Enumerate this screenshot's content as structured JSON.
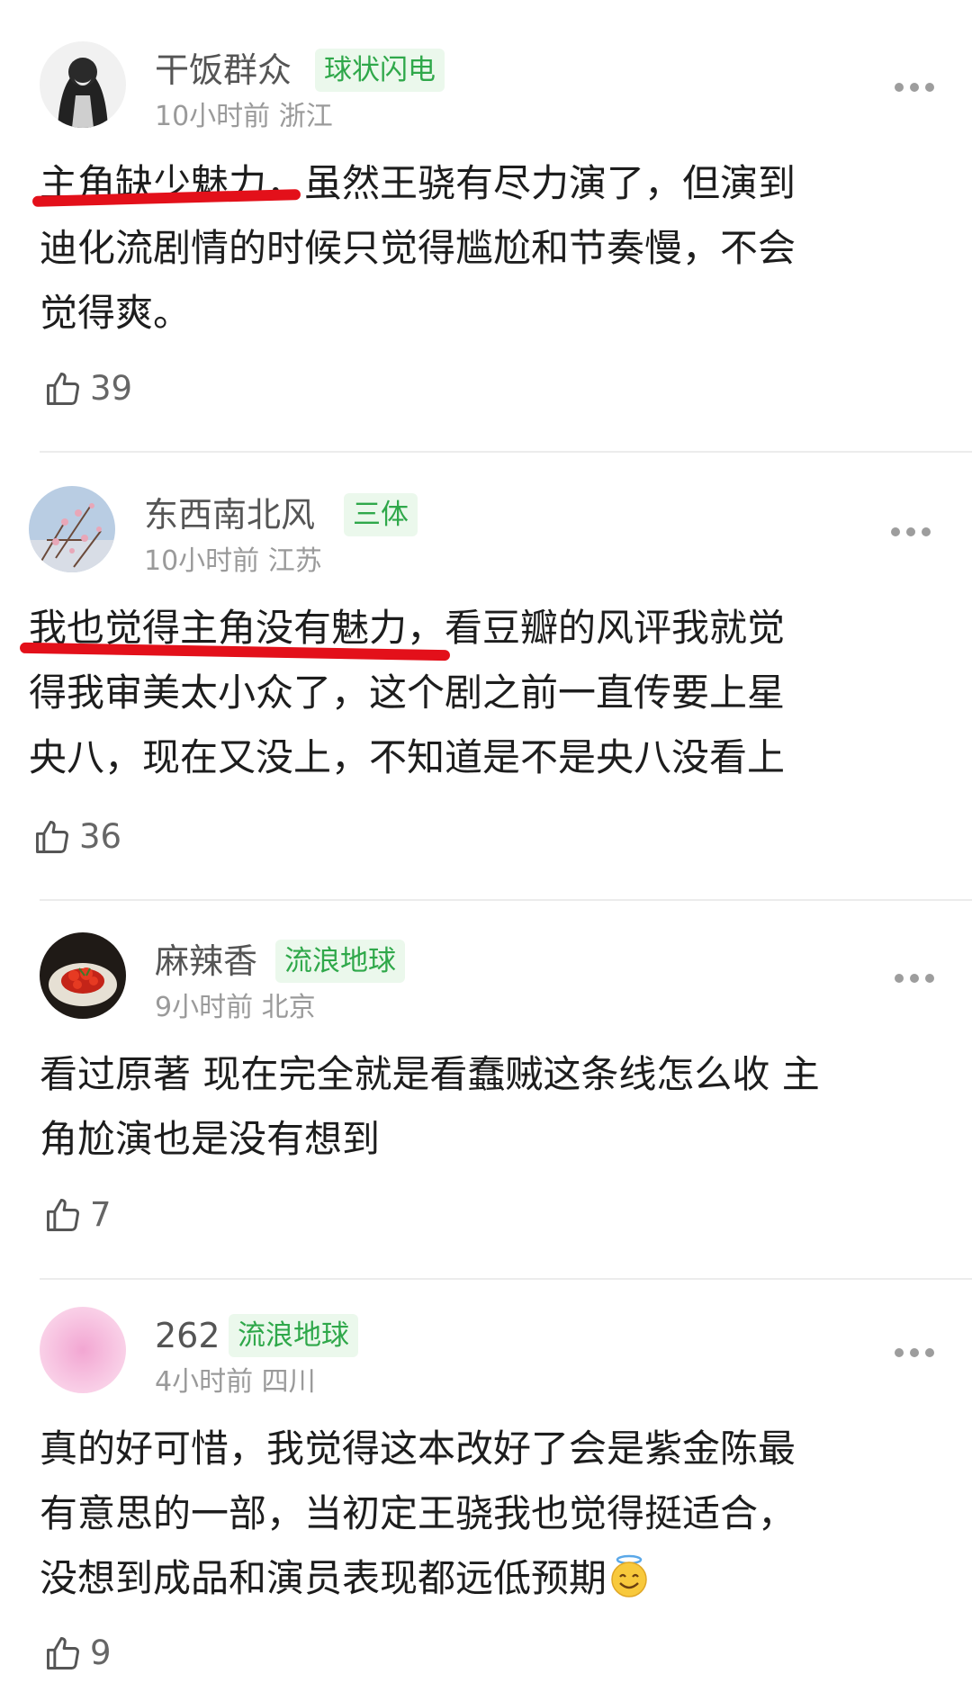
{
  "comments": [
    {
      "username": "干饭群众",
      "badge": "球状闪电",
      "time": "10小时前",
      "location": "浙江",
      "lines": [
        "主角缺少魅力，虽然王骁有尽力演了，但演到",
        "迪化流剧情的时候只觉得尴尬和节奏慢，不会",
        "觉得爽。"
      ],
      "likes": "39"
    },
    {
      "username": "东西南北风",
      "badge": "三体",
      "time": "10小时前",
      "location": "江苏",
      "lines": [
        "我也觉得主角没有魅力，看豆瓣的风评我就觉",
        "得我审美太小众了，这个剧之前一直传要上星",
        "央八，现在又没上，不知道是不是央八没看上"
      ],
      "likes": "36"
    },
    {
      "username": "麻辣香",
      "badge": "流浪地球",
      "time": "9小时前",
      "location": "北京",
      "lines": [
        "看过原著 现在完全就是看蠢贼这条线怎么收 主",
        "角尬演也是没有想到"
      ],
      "likes": "7"
    },
    {
      "username": "262",
      "badge": "流浪地球",
      "time": "4小时前",
      "location": "四川",
      "lines": [
        "真的好可惜，我觉得这本改好了会是紫金陈最",
        "有意思的一部，当初定王骁我也觉得挺适合，",
        "没想到成品和演员表现都远低预期"
      ],
      "likes": "9"
    }
  ],
  "icons": {
    "like": "thumbs-up-icon",
    "more": "more-dots-icon",
    "emoji": "halo-smile-emoji"
  },
  "colors": {
    "badge_bg": "#ebf8ec",
    "badge_text": "#2fa84a",
    "highlight": "#e3101a"
  }
}
